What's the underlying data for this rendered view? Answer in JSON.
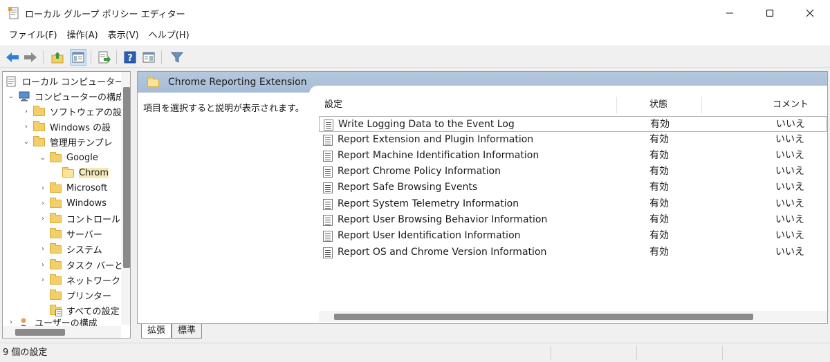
{
  "window": {
    "title": "ローカル グループ ポリシー エディター",
    "minimize_glyph": "—",
    "maximize_glyph": "☐",
    "close_glyph": "✕"
  },
  "menu": {
    "items": [
      "ファイル(F)",
      "操作(A)",
      "表示(V)",
      "ヘルプ(H)"
    ]
  },
  "toolbar": {
    "icons": [
      "back-arrow-icon",
      "forward-arrow-icon",
      "up-folder-icon",
      "show-hide-tree-icon",
      "export-list-icon",
      "help-icon",
      "extended-view-icon",
      "filter-icon"
    ]
  },
  "tree": {
    "items": [
      {
        "label": "ローカル コンピューター ポリ",
        "expander": "",
        "icon": "policy-document-icon"
      },
      {
        "label": "コンピューターの構成",
        "expander": "⌄",
        "icon": "computer-icon"
      },
      {
        "label": "ソフトウェアの設",
        "expander": "›",
        "icon": "folder-icon"
      },
      {
        "label": "Windows の設",
        "expander": "›",
        "icon": "folder-icon"
      },
      {
        "label": "管理用テンプレ",
        "expander": "⌄",
        "icon": "folder-icon"
      },
      {
        "label": "Google",
        "expander": "⌄",
        "icon": "folder-icon"
      },
      {
        "label": "Chrom",
        "expander": "",
        "icon": "folder-open-icon"
      },
      {
        "label": "Microsoft",
        "expander": "›",
        "icon": "folder-icon"
      },
      {
        "label": "Windows",
        "expander": "›",
        "icon": "folder-icon"
      },
      {
        "label": "コントロール",
        "expander": "›",
        "icon": "folder-icon"
      },
      {
        "label": "サーバー",
        "expander": "",
        "icon": "folder-icon"
      },
      {
        "label": "システム",
        "expander": "›",
        "icon": "folder-icon"
      },
      {
        "label": "タスク バーと",
        "expander": "›",
        "icon": "folder-icon"
      },
      {
        "label": "ネットワーク",
        "expander": "›",
        "icon": "folder-icon"
      },
      {
        "label": "プリンター",
        "expander": "",
        "icon": "folder-icon"
      },
      {
        "label": "すべての設定",
        "expander": "",
        "icon": "all-settings-icon"
      },
      {
        "label": "ユーザーの構成",
        "expander": "›",
        "icon": "user-icon"
      }
    ]
  },
  "details": {
    "header_title": "Chrome Reporting Extension",
    "description": "項目を選択すると説明が表示されます。",
    "columns": [
      "設定",
      "状態",
      "コメント"
    ],
    "rows": [
      {
        "name": "Write Logging Data to the Event Log",
        "state": "有効",
        "comment": "いいえ"
      },
      {
        "name": "Report Extension and Plugin Information",
        "state": "有効",
        "comment": "いいえ"
      },
      {
        "name": "Report Machine Identification Information",
        "state": "有効",
        "comment": "いいえ"
      },
      {
        "name": "Report Chrome Policy Information",
        "state": "有効",
        "comment": "いいえ"
      },
      {
        "name": "Report Safe Browsing Events",
        "state": "有効",
        "comment": "いいえ"
      },
      {
        "name": "Report System Telemetry Information",
        "state": "有効",
        "comment": "いいえ"
      },
      {
        "name": "Report User Browsing Behavior Information",
        "state": "有効",
        "comment": "いいえ"
      },
      {
        "name": "Report User Identification Information",
        "state": "有効",
        "comment": "いいえ"
      },
      {
        "name": "Report OS and Chrome Version Information",
        "state": "有効",
        "comment": "いいえ"
      }
    ]
  },
  "tabs": {
    "extended": "拡張",
    "standard": "標準"
  },
  "status": {
    "text": "9 個の設定"
  },
  "colors": {
    "header_band": "#a6bcd7",
    "folder": "#f3cf6a",
    "selected_tree_item": "#f5e8b6"
  }
}
